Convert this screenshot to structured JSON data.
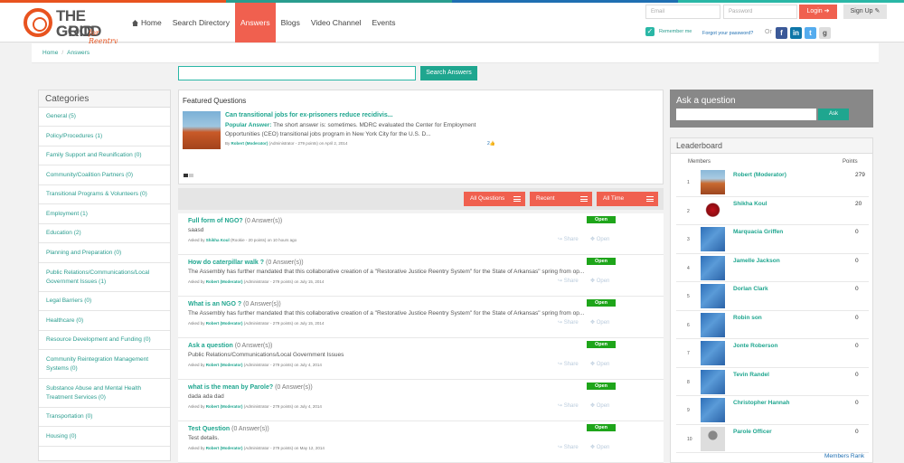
{
  "logo": {
    "line1": "THE GOOD",
    "line2": "GRID",
    "tagline": "for Reentry"
  },
  "nav": {
    "home": "Home",
    "search_directory": "Search Directory",
    "answers": "Answers",
    "blogs": "Blogs",
    "video_channel": "Video Channel",
    "events": "Events"
  },
  "login": {
    "email_placeholder": "Email",
    "password_placeholder": "Password",
    "login_label": "Login",
    "signup_label": "Sign Up",
    "remember": "Remember me",
    "forgot": "Forgot your password?",
    "or": "Or"
  },
  "breadcrumb": {
    "home": "Home",
    "current": "Answers"
  },
  "search": {
    "button": "Search Answers"
  },
  "categories": {
    "title": "Categories",
    "items": [
      "General (5)",
      "Policy/Procedures (1)",
      "Family Support and Reunification (0)",
      "Community/Coalition Partners (0)",
      "Transitional Programs & Volunteers (0)",
      "Employment (1)",
      "Education (2)",
      "Planning and Preparation (0)",
      "Public Relations/Communications/Local Government Issues (1)",
      "Legal Barriers (0)",
      "Healthcare (0)",
      "Resource Development and Funding (0)",
      "Community Reintegration Management Systems (0)",
      "Substance Abuse and Mental Health Treatment Services (0)",
      "Transportation (0)",
      "Housing (0)"
    ]
  },
  "featured": {
    "title": "Featured Questions",
    "question": "Can transitional jobs for ex-prisoners reduce recidivis...",
    "answer_label": "Popular Answer:",
    "answer": "The short answer is: sometimes. MDRC evaluated the Center for Employment Opportunities (CEO) transitional jobs program in New York City for the U.S. D...",
    "by_prefix": "By",
    "author": "Robert (Moderator)",
    "author_meta": "(Administrator - 279 points) on April 2, 2014",
    "likes": "2"
  },
  "filters": {
    "all_questions": "All Questions",
    "recent": "Recent",
    "all_time": "All Time"
  },
  "questions": [
    {
      "title": "Full form of NGO?",
      "count": "(0 Answer(s))",
      "desc": "saasd",
      "asked": "Asked by",
      "author": "Shikha Koul",
      "meta": "(Rookie - 20 points) on 10 hours ago",
      "status": "Open"
    },
    {
      "title": "How do caterpillar walk ?",
      "count": "(0 Answer(s))",
      "desc": "The Assembly has further mandated that this collaborative creation of a \"Restorative Justice Reentry System\" for the State of Arkansas\" spring from op...",
      "asked": "Asked by",
      "author": "Robert (Moderator)",
      "meta": "(Administrator - 279 points) on July 15, 2014",
      "status": "Open"
    },
    {
      "title": "What is an NGO ?",
      "count": "(0 Answer(s))",
      "desc": "The Assembly has further mandated that this collaborative creation of a \"Restorative Justice Reentry System\" for the State of Arkansas\" spring from op...",
      "asked": "Asked by",
      "author": "Robert (Moderator)",
      "meta": "(Administrator - 279 points) on July 15, 2014",
      "status": "Open"
    },
    {
      "title": "Ask a question",
      "count": "(0 Answer(s))",
      "desc": "Public Relations/Communications/Local Government Issues",
      "asked": "Asked by",
      "author": "Robert (Moderator)",
      "meta": "(Administrator - 279 points) on July 4, 2014",
      "status": "Open"
    },
    {
      "title": "what is the mean by Parole?",
      "count": "(0 Answer(s))",
      "desc": "dada ada dad",
      "asked": "Asked by",
      "author": "Robert (Moderator)",
      "meta": "(Administrator - 279 points) on July 4, 2014",
      "status": "Open"
    },
    {
      "title": "Test Question",
      "count": "(0 Answer(s))",
      "desc": "Test details.",
      "asked": "Asked by",
      "author": "Robert (Moderator)",
      "meta": "(Administrator - 279 points) on May 12, 2014",
      "status": "Open"
    }
  ],
  "q_actions": {
    "share": "Share",
    "open": "Open"
  },
  "ask": {
    "title": "Ask a question",
    "button": "Ask"
  },
  "leaderboard": {
    "title": "Leaderboard",
    "col_members": "Members",
    "col_points": "Points",
    "more": "Members Rank",
    "rows": [
      {
        "rank": "1",
        "name": "Robert (Moderator)",
        "points": "279",
        "avatar": "canyon"
      },
      {
        "rank": "2",
        "name": "Shikha Koul",
        "points": "20",
        "avatar": "rose"
      },
      {
        "rank": "3",
        "name": "Marquacia Griffen",
        "points": "0",
        "avatar": "blue"
      },
      {
        "rank": "4",
        "name": "Jamelle Jackson",
        "points": "0",
        "avatar": "blue"
      },
      {
        "rank": "5",
        "name": "Dorlan Clark",
        "points": "0",
        "avatar": "blue"
      },
      {
        "rank": "6",
        "name": "Robin son",
        "points": "0",
        "avatar": "blue"
      },
      {
        "rank": "7",
        "name": "Jonte Roberson",
        "points": "0",
        "avatar": "blue"
      },
      {
        "rank": "8",
        "name": "Tevin Randel",
        "points": "0",
        "avatar": "blue"
      },
      {
        "rank": "9",
        "name": "Christopher Hannah",
        "points": "0",
        "avatar": "blue"
      },
      {
        "rank": "10",
        "name": "Parole Officer",
        "points": "0",
        "avatar": "person"
      }
    ]
  }
}
